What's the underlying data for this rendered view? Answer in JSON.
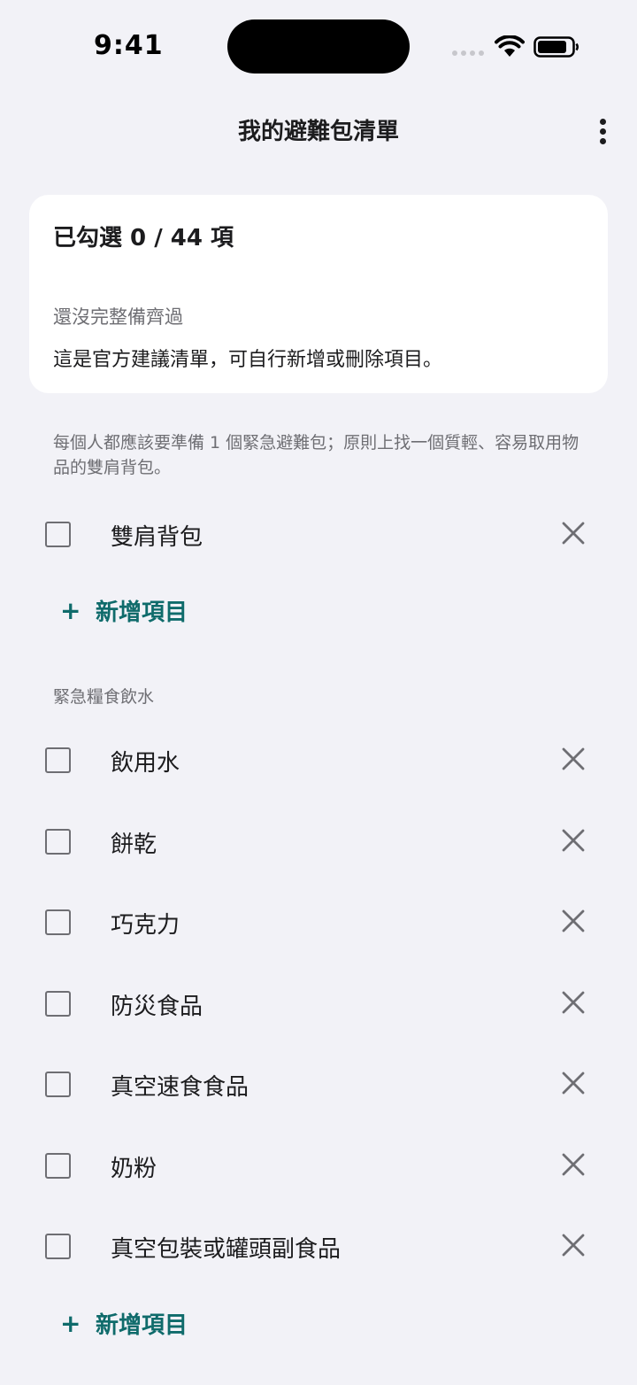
{
  "status_bar": {
    "time": "9:41"
  },
  "nav": {
    "title": "我的避難包清單",
    "more_icon": "more-vertical-icon"
  },
  "summary": {
    "count": "已勾選 0 / 44 項",
    "status": "還沒完整備齊過",
    "note": "這是官方建議清單，可自行新增或刪除項目。"
  },
  "sections": [
    {
      "description": "每個人都應該要準備 1 個緊急避難包；原則上找一個質輕、容易取用物品的雙肩背包。",
      "items": [
        {
          "label": "雙肩背包",
          "checked": false
        }
      ],
      "add_label": "新增項目",
      "add_icon": "+"
    },
    {
      "header": "緊急糧食飲水",
      "items": [
        {
          "label": "飲用水",
          "checked": false
        },
        {
          "label": "餅乾",
          "checked": false
        },
        {
          "label": "巧克力",
          "checked": false
        },
        {
          "label": "防災食品",
          "checked": false
        },
        {
          "label": "真空速食食品",
          "checked": false
        },
        {
          "label": "奶粉",
          "checked": false
        },
        {
          "label": "真空包裝或罐頭副食品",
          "checked": false
        }
      ],
      "add_label": "新增項目",
      "add_icon": "+"
    }
  ],
  "colors": {
    "background": "#f2f2f7",
    "accent": "#0f6b6b",
    "secondary_text": "#6e6e73"
  }
}
